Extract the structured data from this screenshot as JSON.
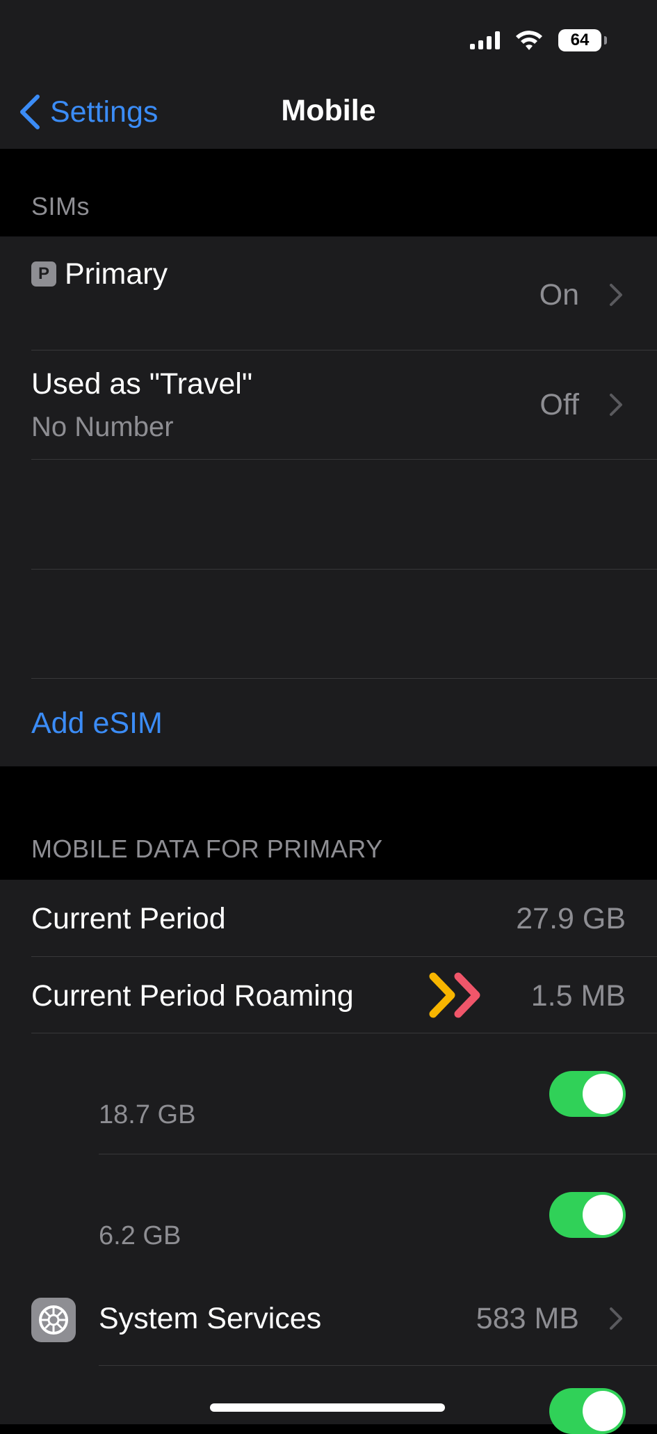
{
  "status_bar": {
    "battery": "64"
  },
  "nav": {
    "back_label": "Settings",
    "title": "Mobile"
  },
  "sims_section": {
    "header": "SIMs",
    "rows": [
      {
        "badge": "P",
        "title": "Primary",
        "value": "On"
      },
      {
        "title": "Used as \"Travel\"",
        "subtitle": "No Number",
        "value": "Off"
      }
    ],
    "add_esim_label": "Add eSIM"
  },
  "data_section": {
    "header": "MOBILE DATA FOR PRIMARY",
    "current_period": {
      "label": "Current Period",
      "value": "27.9 GB"
    },
    "current_period_roaming": {
      "label": "Current Period Roaming",
      "value": "1.5 MB"
    },
    "app_rows": [
      {
        "usage": "18.7 GB",
        "enabled": true
      },
      {
        "usage": "6.2 GB",
        "enabled": true
      }
    ],
    "system_services": {
      "label": "System Services",
      "value": "583 MB"
    },
    "last_row": {
      "enabled": true
    }
  },
  "colors": {
    "accent": "#3b8cf6",
    "toggle_on": "#30d158",
    "annotation_yellow": "#f7b500",
    "annotation_red": "#f0566a"
  }
}
